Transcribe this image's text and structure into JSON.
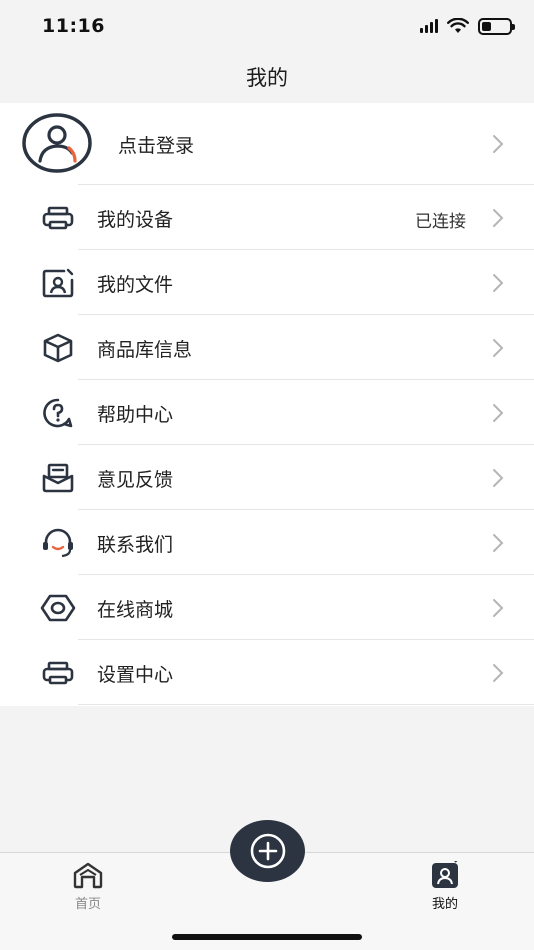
{
  "status_bar": {
    "time": "11:16",
    "icons": [
      "signal-icon",
      "wifi-icon",
      "battery-icon"
    ],
    "battery_level": 0.35
  },
  "header": {
    "title": "我的"
  },
  "login": {
    "label": "点击登录",
    "avatar_icon": "user-avatar-icon"
  },
  "menu": {
    "items": [
      {
        "label": "我的设备",
        "status": "已连接",
        "icon": "printer-icon"
      },
      {
        "label": "我的文件",
        "status": "",
        "icon": "file-profile-icon"
      },
      {
        "label": "商品库信息",
        "status": "",
        "icon": "box-icon"
      },
      {
        "label": "帮助中心",
        "status": "",
        "icon": "help-icon"
      },
      {
        "label": "意见反馈",
        "status": "",
        "icon": "feedback-icon"
      },
      {
        "label": "联系我们",
        "status": "",
        "icon": "headset-icon"
      },
      {
        "label": "在线商城",
        "status": "",
        "icon": "shop-icon"
      },
      {
        "label": "设置中心",
        "status": "",
        "icon": "printer-settings-icon"
      }
    ]
  },
  "tab_bar": {
    "tabs": [
      {
        "label": "首页",
        "icon": "home-icon",
        "active": false
      },
      {
        "label": "我的",
        "icon": "profile-icon",
        "active": true
      }
    ],
    "fab_icon": "plus-circle-icon"
  },
  "colors": {
    "accent": "#e8643c",
    "dark": "#2b3440",
    "background": "#f3f3f3"
  }
}
